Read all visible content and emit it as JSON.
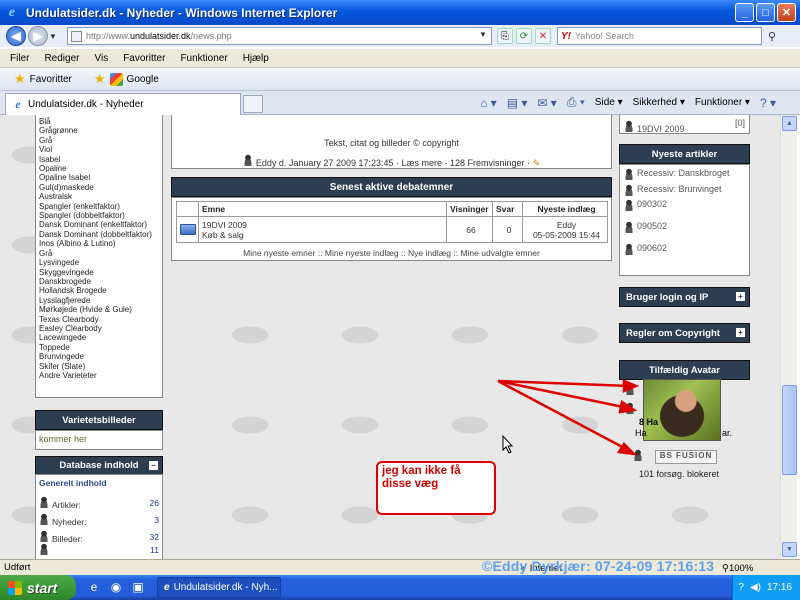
{
  "window": {
    "title": "Undulatsider.dk - Nyheder - Windows Internet Explorer",
    "minimize": "_",
    "maximize": "□",
    "close": "✕"
  },
  "address": {
    "url_prefix": "http://www.",
    "url_domain": "undulatsider.dk",
    "url_path": "/news.php"
  },
  "search": {
    "placeholder": "Yahoo! Search"
  },
  "menu": [
    "Filer",
    "Rediger",
    "Vis",
    "Favoritter",
    "Funktioner",
    "Hjælp"
  ],
  "favorites": {
    "favorites_label": "Favoritter",
    "google_label": "Google"
  },
  "tab": {
    "label": "Undulatsider.dk - Nyheder"
  },
  "commandbar": {
    "page": "Side",
    "security": "Sikkerhed",
    "tools": "Funktioner"
  },
  "left": {
    "varieties": [
      "Blå",
      "Grågrønne",
      "Grå",
      "Viol",
      "Isabel",
      "Opaline",
      "Opaline Isabel",
      "Gul(d)maskede",
      "Australsk",
      "Spangler (enkeltfaktor)",
      "Spangler (dobbeltfaktor)",
      "Dansk Dominant (enkeltfaktor)",
      "Dansk Dominant (dobbeltfaktor)",
      "Inos (Albino & Lutino)",
      "Grå",
      "Lysvingede",
      "Skyggevingede",
      "Danskbrogede",
      "Hollandsk Brogede",
      "Lysslagfjerede",
      "Mørkøjede (Hvide & Gule)",
      "Texas Clearbody",
      "Easley Clearbody",
      "Lacewingede",
      "Toppede",
      "Brunvingede",
      "Skifer (Slate)",
      "Andre Varieteter"
    ],
    "variety_images_title": "Varietetsbilleder",
    "variety_images_text": "kommer her",
    "database_title": "Database indhold",
    "database_sub": "Generelt indhold",
    "database_rows": [
      {
        "label": "Artikler:",
        "value": "26"
      },
      {
        "label": "Nyheder:",
        "value": "3"
      },
      {
        "label": "Billeder:",
        "value": "32"
      },
      {
        "label": "",
        "value": "11"
      }
    ]
  },
  "news": {
    "line1": "Tekst, citat og billeder © copyright",
    "line2": "Eddy d. January 27 2009 17:23:45 · Læs mere · 128 Fremvisninger ·"
  },
  "debate": {
    "title": "Senest aktive debatemner",
    "headers": [
      "Emne",
      "Visninger",
      "Svar",
      "Nyeste indlæg"
    ],
    "row": {
      "topic": "19DVI 2009",
      "forum": "Køb & salg",
      "views": "66",
      "replies": "0",
      "last_user": "Eddy",
      "last_date": "05-05-2009 15:44"
    },
    "links": "Mine nyeste emner :: Mine nyeste indlæg :: Nye indlæg :: Mine udvalgte emner"
  },
  "right": {
    "top_item": "19DVI 2009",
    "top_count": "[0]",
    "articles_title": "Nyeste artikler",
    "articles": [
      "Recessiv: Danskbroget",
      "Recessiv: Brunvinget",
      "090302",
      "090502",
      "090602"
    ],
    "login_title": "Bruger login og IP",
    "copyright_title": "Regler om Copyright",
    "avatar_title": "Tilfældig Avatar",
    "avatar_caption_1": "8 Ha",
    "avatar_caption_2": "Ha",
    "avatar_caption_3": "ar.",
    "bsfusion": "BS FUSION",
    "blocked": "101 forsøg. blokeret"
  },
  "annotation": {
    "text": "jeg kan ikke få disse væg"
  },
  "status": {
    "left": "Udført",
    "zone": "Internet",
    "zoom": "100%"
  },
  "watermark": "©Eddy Dyrkjær: 07-24-09 17:16:13",
  "taskbar": {
    "start": "start",
    "task": "Undulatsider.dk - Nyh...",
    "clock": "17:16"
  },
  "colors": {
    "panel_header": "#2e3e52",
    "annotation": "#dd0000",
    "title_bar": "#0454d8"
  }
}
